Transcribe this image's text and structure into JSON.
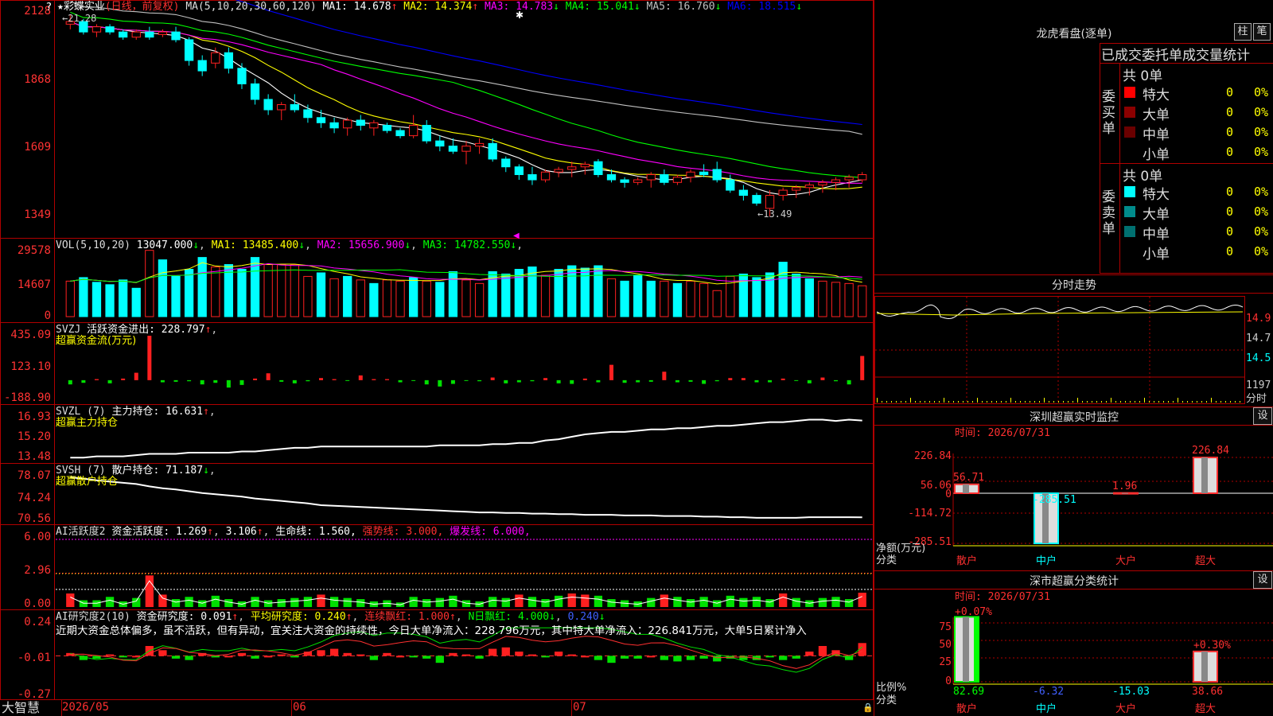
{
  "colors": {
    "up": "#ff2020",
    "down": "#00ffff",
    "frame": "#b00000",
    "ma1": "#ffffff",
    "ma2": "#ffff00",
    "ma3": "#ff00ff",
    "ma4": "#00ff00",
    "ma5": "#c0c0c0",
    "ma6": "#0000ff"
  },
  "header": {
    "title": "彩蝶实业",
    "period": "(日线，前复权)",
    "ma_label": "MA(5,10,20,30,60,120)",
    "ma": [
      {
        "label": "MA1:",
        "value": "14.678",
        "arrow": "↑",
        "color": "#ffffff"
      },
      {
        "label": "MA2:",
        "value": "14.374",
        "arrow": "↑",
        "color": "#ffff00"
      },
      {
        "label": "MA3:",
        "value": "14.783",
        "arrow": "↓",
        "color": "#ff00ff"
      },
      {
        "label": "MA4:",
        "value": "15.041",
        "arrow": "↓",
        "color": "#00ff00"
      },
      {
        "label": "MA5:",
        "value": "16.760",
        "arrow": "↓",
        "color": "#c0c0c0"
      },
      {
        "label": "MA6:",
        "value": "18.515",
        "arrow": "↓",
        "color": "#0000ff"
      }
    ],
    "high_note": "21.28",
    "low_note": "13.49"
  },
  "price_axis": [
    "2128",
    "1868",
    "1609",
    "1349"
  ],
  "vol": {
    "label": "VOL(5,10,20)",
    "value": "13047.000",
    "arrow": "↓",
    "ma": [
      {
        "label": "MA1:",
        "value": "13485.400",
        "arrow": "↓",
        "color": "#ffff00"
      },
      {
        "label": "MA2:",
        "value": "15656.900",
        "arrow": "↓",
        "color": "#ff00ff"
      },
      {
        "label": "MA3:",
        "value": "14782.550",
        "arrow": "↓",
        "color": "#00ff00"
      }
    ],
    "axis": [
      "29578",
      "14607",
      "0"
    ]
  },
  "svzj": {
    "label": "SVZJ",
    "name": "活跃资金进出:",
    "value": "228.797",
    "arrow": "↑",
    "sub": "超赢资金流(万元)",
    "axis": [
      "435.09",
      "123.10",
      "-188.90"
    ]
  },
  "svzl": {
    "label": "SVZL (7)",
    "name": "主力持仓:",
    "value": "16.631",
    "arrow": "↑",
    "sub": "超赢主力持仓",
    "axis": [
      "16.93",
      "15.20",
      "13.48"
    ]
  },
  "svsh": {
    "label": "SVSH (7)",
    "name": "散户持仓:",
    "value": "71.187",
    "arrow": "↓",
    "sub": "超赢散户持仓",
    "axis": [
      "78.07",
      "74.24",
      "70.56"
    ]
  },
  "ai1": {
    "label": "AI活跃度2",
    "name": "资金活跃度:",
    "value": "1.269",
    "v2": "3.106",
    "life": "生命线: 1.560,",
    "strong": "强势线: 3.000,",
    "burst": "爆发线: 6.000,",
    "axis": [
      "6.00",
      "2.96",
      "0.00"
    ]
  },
  "ai2": {
    "label": "AI研究度2(10)",
    "name": "资金研究度:",
    "value": "0.091",
    "avg": "平均研究度: 0.240",
    "cont": "连续飘红: 1.000",
    "nday": "N日飘红: 4.000",
    "last": "0.240",
    "axis": [
      "0.24",
      "-0.01",
      "-0.27"
    ],
    "comment": "近期大资金总体偏多，虽不活跃，但有异动，宜关注大资金的持续性，今日大单净流入：228.796万元，其中特大单净流入：226.841万元，大单5日累计净入"
  },
  "xaxis": {
    "brand": "大智慧",
    "labels": [
      "2026/05",
      "06",
      "07"
    ]
  },
  "right": {
    "lhb_title": "龙虎看盘(逐单)",
    "btn1": "柱",
    "btn2": "笔",
    "table_title": "已成交委托单成交量统计",
    "buy": {
      "side": "委买单",
      "total": "共 0单",
      "rows": [
        {
          "name": "特大",
          "v": "0",
          "p": "0%",
          "color": "#ff0000"
        },
        {
          "name": "大单",
          "v": "0",
          "p": "0%",
          "color": "#8b0000"
        },
        {
          "name": "中单",
          "v": "0",
          "p": "0%",
          "color": "#6a0000"
        },
        {
          "name": "小单",
          "v": "0",
          "p": "0%",
          "color": ""
        }
      ]
    },
    "sell": {
      "side": "委卖单",
      "total": "共 0单",
      "rows": [
        {
          "name": "特大",
          "v": "0",
          "p": "0%",
          "color": "#00ffff"
        },
        {
          "name": "大单",
          "v": "0",
          "p": "0%",
          "color": "#008b8b"
        },
        {
          "name": "中单",
          "v": "0",
          "p": "0%",
          "color": "#007070"
        },
        {
          "name": "小单",
          "v": "0",
          "p": "0%",
          "color": ""
        }
      ]
    },
    "fs_title": "分时走势",
    "fs_axis": [
      "14.9",
      "14.7",
      "14.5",
      "1197",
      "分时"
    ],
    "monitor": {
      "title": "深圳超赢实时监控",
      "btn": "设",
      "time": "时间: 2026/07/31",
      "ylabels": [
        "226.84",
        "56.06",
        "0",
        "-114.72",
        "-285.51"
      ],
      "ylabel": "净额(万元)",
      "xlabel": "分类",
      "categories": [
        "散户",
        "中户",
        "大户",
        "超大"
      ],
      "values": [
        56.71,
        -285.51,
        1.96,
        226.84
      ],
      "value_labels": [
        "56.71",
        "-285.51",
        "1.96",
        "226.84"
      ]
    },
    "stats": {
      "title": "深市超赢分类统计",
      "btn": "设",
      "time": "时间: 2026/07/31",
      "ylabels": [
        "75",
        "50",
        "25",
        "0"
      ],
      "ylabel": "比例%",
      "xlabel": "分类",
      "categories": [
        "散户",
        "中户",
        "大户",
        "超大"
      ],
      "values": [
        82.69,
        -6.32,
        -15.03,
        38.66
      ],
      "value_labels": [
        "82.69",
        "-6.32",
        "-15.03",
        "38.66"
      ],
      "top_labels": [
        "+0.07%",
        "+0.30%"
      ]
    }
  },
  "chart_data": [
    {
      "type": "candlestick",
      "title": "彩蝶实业",
      "ylim": [
        13.49,
        21.28
      ],
      "ohlc": [
        [
          20.9,
          21.28,
          20.7,
          21.0
        ],
        [
          21.0,
          21.1,
          20.5,
          20.6
        ],
        [
          20.6,
          20.9,
          20.4,
          20.8
        ],
        [
          20.8,
          20.9,
          20.5,
          20.6
        ],
        [
          20.6,
          20.7,
          20.3,
          20.4
        ],
        [
          20.4,
          20.7,
          20.3,
          20.6
        ],
        [
          20.6,
          20.8,
          20.3,
          20.4
        ],
        [
          20.5,
          20.7,
          20.4,
          20.6
        ],
        [
          20.6,
          20.8,
          20.2,
          20.3
        ],
        [
          20.3,
          20.4,
          19.3,
          19.5
        ],
        [
          19.5,
          19.7,
          18.9,
          19.1
        ],
        [
          19.4,
          20.0,
          19.2,
          19.8
        ],
        [
          19.8,
          20.0,
          19.0,
          19.2
        ],
        [
          19.2,
          19.4,
          18.4,
          18.6
        ],
        [
          18.6,
          18.8,
          17.8,
          18.0
        ],
        [
          18.0,
          18.2,
          17.4,
          17.6
        ],
        [
          17.6,
          17.9,
          17.2,
          17.8
        ],
        [
          17.8,
          18.2,
          17.5,
          17.6
        ],
        [
          17.6,
          17.8,
          17.1,
          17.3
        ],
        [
          17.3,
          17.6,
          16.9,
          17.1
        ],
        [
          17.1,
          17.3,
          16.7,
          16.9
        ],
        [
          16.9,
          17.3,
          16.6,
          17.2
        ],
        [
          17.2,
          17.4,
          16.8,
          17.0
        ],
        [
          16.9,
          17.2,
          16.6,
          17.1
        ],
        [
          17.0,
          17.1,
          16.7,
          16.8
        ],
        [
          16.8,
          16.9,
          16.5,
          16.6
        ],
        [
          16.6,
          17.4,
          16.5,
          17.0
        ],
        [
          17.0,
          17.2,
          16.3,
          16.4
        ],
        [
          16.4,
          16.6,
          16.0,
          16.2
        ],
        [
          16.2,
          16.5,
          15.9,
          16.0
        ],
        [
          16.0,
          16.4,
          15.5,
          16.2
        ],
        [
          16.2,
          16.5,
          15.9,
          16.3
        ],
        [
          16.3,
          16.5,
          15.6,
          15.7
        ],
        [
          15.7,
          15.8,
          15.2,
          15.4
        ],
        [
          15.4,
          15.5,
          14.9,
          15.1
        ],
        [
          15.1,
          15.4,
          14.7,
          14.9
        ],
        [
          14.9,
          15.3,
          14.8,
          15.2
        ],
        [
          15.2,
          15.4,
          15.0,
          15.3
        ],
        [
          15.3,
          15.6,
          15.0,
          15.4
        ],
        [
          15.4,
          15.6,
          15.1,
          15.5
        ],
        [
          15.6,
          15.7,
          15.0,
          15.1
        ],
        [
          15.1,
          15.3,
          14.8,
          14.9
        ],
        [
          14.9,
          15.0,
          14.6,
          14.8
        ],
        [
          14.8,
          15.0,
          14.7,
          14.9
        ],
        [
          14.9,
          15.2,
          14.6,
          15.1
        ],
        [
          15.1,
          15.3,
          14.7,
          14.8
        ],
        [
          14.8,
          15.1,
          14.7,
          15.0
        ],
        [
          15.0,
          15.3,
          14.8,
          15.2
        ],
        [
          15.2,
          15.5,
          15.0,
          15.1
        ],
        [
          15.3,
          15.6,
          14.8,
          14.9
        ],
        [
          14.9,
          15.1,
          14.4,
          14.5
        ],
        [
          14.5,
          14.7,
          14.1,
          14.3
        ],
        [
          14.3,
          14.4,
          13.9,
          14.0
        ],
        [
          13.8,
          14.5,
          13.49,
          14.3
        ],
        [
          14.3,
          14.6,
          14.1,
          14.5
        ],
        [
          14.5,
          14.7,
          14.2,
          14.6
        ],
        [
          14.6,
          14.8,
          14.3,
          14.7
        ],
        [
          14.7,
          14.9,
          14.4,
          14.8
        ],
        [
          14.8,
          15.0,
          14.5,
          14.9
        ],
        [
          14.9,
          15.1,
          14.6,
          15.0
        ],
        [
          14.9,
          15.2,
          14.8,
          15.1
        ]
      ]
    },
    {
      "type": "bar",
      "title": "VOL(5,10,20)",
      "ylim": [
        0,
        29578
      ],
      "values": [
        15000,
        16500,
        14500,
        13500,
        15500,
        12000,
        28000,
        24000,
        17000,
        20000,
        25000,
        21000,
        22000,
        20000,
        25000,
        22000,
        22000,
        22000,
        17000,
        18500,
        16000,
        17000,
        15500,
        14000,
        15500,
        15000,
        16500,
        15000,
        14500,
        19000,
        15500,
        14000,
        19000,
        18000,
        20000,
        21000,
        17500,
        20000,
        21500,
        20500,
        21500,
        16000,
        15000,
        17500,
        15000,
        15000,
        14000,
        15000,
        14000,
        11000,
        17000,
        18000,
        16500,
        18500,
        23000,
        18000,
        16000,
        15000,
        14500,
        14000,
        13047
      ],
      "up": [
        1,
        0,
        0,
        0,
        0,
        0,
        1,
        0,
        0,
        0,
        0,
        1,
        0,
        0,
        0,
        1,
        1,
        1,
        1,
        0,
        1,
        0,
        1,
        0,
        1,
        1,
        0,
        1,
        0,
        0,
        1,
        1,
        0,
        0,
        0,
        0,
        1,
        0,
        0,
        0,
        0,
        1,
        0,
        0,
        0,
        1,
        0,
        1,
        1,
        1,
        1,
        0,
        0,
        0,
        0,
        0,
        0,
        1,
        1,
        1,
        1
      ]
    },
    {
      "type": "bar",
      "title": "SVZJ",
      "ylim": [
        -188.9,
        435.09
      ],
      "values": [
        -40,
        -25,
        10,
        -30,
        15,
        70,
        420,
        -20,
        -15,
        -10,
        -40,
        -25,
        -70,
        -45,
        15,
        65,
        -15,
        -30,
        -10,
        20,
        10,
        -5,
        45,
        10,
        10,
        -20,
        -5,
        -40,
        -60,
        -35,
        -5,
        -10,
        25,
        -30,
        -20,
        -10,
        20,
        -30,
        -35,
        15,
        -20,
        145,
        -25,
        -20,
        -15,
        80,
        -20,
        -15,
        -35,
        -10,
        20,
        20,
        -20,
        -20,
        15,
        -5,
        -30,
        25,
        -10,
        -40,
        228.797
      ]
    },
    {
      "type": "line",
      "title": "SVZL",
      "ylim": [
        13.48,
        16.93
      ],
      "values": [
        13.6,
        13.6,
        13.7,
        13.7,
        13.7,
        13.8,
        13.9,
        13.9,
        13.9,
        14.0,
        14.0,
        14.0,
        14.0,
        14.1,
        14.1,
        14.2,
        14.3,
        14.4,
        14.4,
        14.5,
        14.5,
        14.5,
        14.5,
        14.5,
        14.5,
        14.5,
        14.5,
        14.5,
        14.6,
        14.6,
        14.6,
        14.6,
        14.7,
        14.7,
        14.8,
        14.8,
        15.0,
        15.1,
        15.3,
        15.5,
        15.6,
        15.7,
        15.7,
        15.8,
        15.9,
        15.9,
        16.0,
        16.0,
        16.1,
        16.2,
        16.2,
        16.3,
        16.4,
        16.5,
        16.5,
        16.6,
        16.7,
        16.7,
        16.6,
        16.7,
        16.631
      ]
    },
    {
      "type": "line",
      "title": "SVSH",
      "ylim": [
        70.56,
        78.07
      ],
      "values": [
        77.8,
        77.6,
        77.3,
        77.1,
        76.9,
        76.7,
        76.3,
        76.0,
        75.8,
        75.5,
        75.2,
        75.0,
        74.8,
        74.6,
        74.3,
        74.1,
        73.9,
        73.7,
        73.5,
        73.2,
        73.1,
        73.0,
        72.9,
        72.8,
        72.7,
        72.6,
        72.5,
        72.4,
        72.3,
        72.2,
        72.1,
        72.0,
        72.0,
        71.9,
        71.9,
        71.8,
        71.8,
        71.7,
        71.7,
        71.6,
        71.6,
        71.6,
        71.5,
        71.5,
        71.5,
        71.4,
        71.4,
        71.4,
        71.3,
        71.3,
        71.2,
        71.2,
        71.1,
        71.1,
        71.1,
        71.1,
        71.2,
        71.2,
        71.2,
        71.2,
        71.187
      ]
    },
    {
      "type": "bar",
      "title": "AI活跃度2",
      "ylim": [
        0,
        6.0
      ],
      "values": [
        1.2,
        0.6,
        0.6,
        0.9,
        0.5,
        0.8,
        2.8,
        1.1,
        0.7,
        0.9,
        0.6,
        1.0,
        0.7,
        0.5,
        0.9,
        0.6,
        0.7,
        0.8,
        0.9,
        1.1,
        0.9,
        0.8,
        0.7,
        0.5,
        0.6,
        0.4,
        0.9,
        0.7,
        0.8,
        1.0,
        0.6,
        0.5,
        0.9,
        0.8,
        1.1,
        0.9,
        0.7,
        1.0,
        1.2,
        1.1,
        1.0,
        0.7,
        0.6,
        0.5,
        0.8,
        1.1,
        0.9,
        0.7,
        0.9,
        0.6,
        1.0,
        0.8,
        0.9,
        0.7,
        1.2,
        0.8,
        0.6,
        0.8,
        0.9,
        0.7,
        1.269
      ]
    },
    {
      "type": "bar",
      "title": "AI研究度2(10)",
      "ylim": [
        -0.27,
        0.24
      ],
      "values": [
        0.02,
        -0.03,
        -0.02,
        0.01,
        -0.01,
        0.0,
        0.07,
        0.04,
        -0.02,
        -0.03,
        0.02,
        -0.01,
        0.0,
        0.02,
        -0.02,
        0.0,
        0.01,
        -0.01,
        0.03,
        0.04,
        0.05,
        0.02,
        0.01,
        -0.03,
        0.02,
        0.0,
        -0.01,
        -0.02,
        -0.05,
        0.02,
        0.01,
        -0.02,
        0.05,
        0.06,
        0.03,
        0.01,
        -0.01,
        0.03,
        0.01,
        0.0,
        -0.03,
        -0.05,
        -0.02,
        -0.02,
        0.0,
        -0.03,
        -0.04,
        -0.03,
        -0.02,
        -0.04,
        -0.02,
        -0.03,
        -0.03,
        -0.01,
        -0.03,
        -0.02,
        0.03,
        0.07,
        0.04,
        -0.03,
        0.091
      ]
    },
    {
      "type": "bar",
      "title": "深圳超赢实时监控",
      "categories": [
        "散户",
        "中户",
        "大户",
        "超大"
      ],
      "values": [
        56.71,
        -285.51,
        1.96,
        226.84
      ],
      "ylim": [
        -285.51,
        226.84
      ],
      "ylabel": "净额(万元)"
    },
    {
      "type": "bar",
      "title": "深市超赢分类统计",
      "categories": [
        "散户",
        "中户",
        "大户",
        "超大"
      ],
      "values": [
        82.69,
        -6.32,
        -15.03,
        38.66
      ],
      "ylim": [
        0,
        75
      ],
      "ylabel": "比例%"
    }
  ]
}
